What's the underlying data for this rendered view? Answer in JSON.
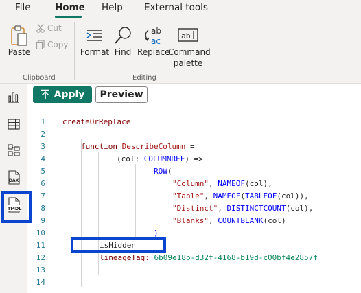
{
  "menu": {
    "file": "File",
    "home": "Home",
    "help": "Help",
    "external_tools": "External tools"
  },
  "ribbon": {
    "paste": "Paste",
    "cut": "Cut",
    "copy": "Copy",
    "clipboard_group": "Clipboard",
    "format": "Format",
    "find": "Find",
    "replace": "Replace",
    "command_line1": "Command",
    "command_line2": "palette",
    "editing_group": "Editing"
  },
  "toolbar": {
    "apply": "Apply",
    "preview": "Preview"
  },
  "rail": {
    "tmdl_label": "TMDL",
    "dax_label": "DAX"
  },
  "editor": {
    "line_numbers": [
      "1",
      "2",
      "3",
      "4",
      "5",
      "6",
      "7",
      "8",
      "9",
      "10",
      "11",
      "12",
      "13",
      "14"
    ],
    "l1": "createOrReplace",
    "l3_kw": "function",
    "l3_name": "DescribeColumn",
    "l3_eq": " =",
    "l4_a": "(col: ",
    "l4_type": "COLUMNREF",
    "l4_b": ") =>",
    "l5_fn": "ROW",
    "l5_paren": "(",
    "l6_str": "\"Column\"",
    "l6_sep": ", ",
    "l6_fn": "NAMEOF",
    "l6_rest": "(col),",
    "l7_str": "\"Table\"",
    "l7_sep": ", ",
    "l7_fn1": "NAMEOF",
    "l7_mid": "(",
    "l7_fn2": "TABLEOF",
    "l7_rest": "(col)),",
    "l8_str": "\"Distinct\"",
    "l8_sep": ", ",
    "l8_fn": "DISTINCTCOUNT",
    "l8_rest": "(col),",
    "l9_str": "\"Blanks\"",
    "l9_sep": ", ",
    "l9_fn": "COUNTBLANK",
    "l9_rest": "(col)",
    "l10": ")",
    "l11": "isHidden",
    "l12_key": "lineageTag:",
    "l12_val": " 6b09e18b-d32f-4168-b19d-c00bf4e2857f"
  }
}
